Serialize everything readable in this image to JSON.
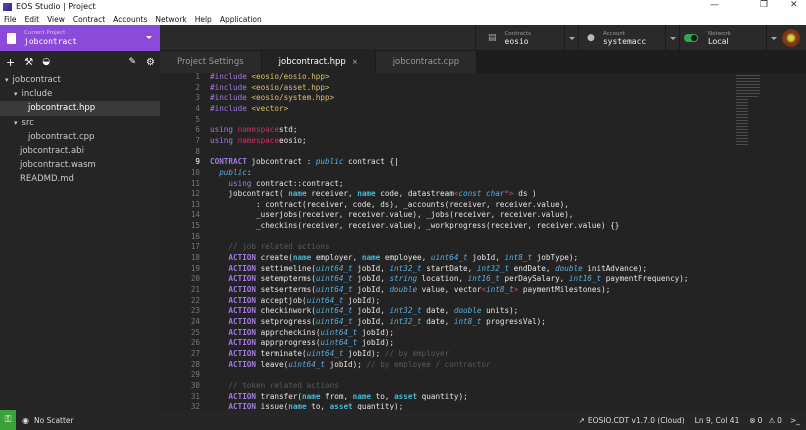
{
  "window": {
    "title": "EOS Studio | Project",
    "min": "—",
    "max": "❐",
    "close": "✕"
  },
  "menu": [
    "File",
    "Edit",
    "View",
    "Contract",
    "Accounts",
    "Network",
    "Help",
    "Application"
  ],
  "project": {
    "label": "Current Project",
    "value": "jobcontract"
  },
  "header": {
    "contracts": {
      "label": "Contracts",
      "value": "eosio"
    },
    "account": {
      "label": "Account",
      "value": "systemacc"
    },
    "network": {
      "label": "Network",
      "value": "Local"
    }
  },
  "tabs": [
    {
      "label": "Project Settings"
    },
    {
      "label": "jobcontract.hpp",
      "close": "×"
    },
    {
      "label": "jobcontract.cpp"
    }
  ],
  "tree": [
    {
      "label": "jobcontract",
      "arrow": "▾",
      "depth": 0
    },
    {
      "label": "include",
      "arrow": "▾",
      "depth": 1
    },
    {
      "label": "jobcontract.hpp",
      "depth": 2,
      "active": true
    },
    {
      "label": "src",
      "arrow": "▾",
      "depth": 1
    },
    {
      "label": "jobcontract.cpp",
      "depth": 2
    },
    {
      "label": "jobcontract.abi",
      "depth": 1
    },
    {
      "label": "jobcontract.wasm",
      "depth": 1
    },
    {
      "label": "READMD.md",
      "depth": 1
    }
  ],
  "code": [
    [
      [
        "u",
        "#include "
      ],
      [
        "s",
        "<eosio/eosio.hpp>"
      ]
    ],
    [
      [
        "u",
        "#include "
      ],
      [
        "s",
        "<eosio/asset.hpp>"
      ]
    ],
    [
      [
        "u",
        "#include "
      ],
      [
        "s",
        "<eosio/system.hpp>"
      ]
    ],
    [
      [
        "u",
        "#include "
      ],
      [
        "s",
        "<vector>"
      ]
    ],
    [],
    [
      [
        "u",
        "using "
      ],
      [
        "p",
        "namespace"
      ],
      [
        "",
        "std;"
      ]
    ],
    [
      [
        "u",
        "using "
      ],
      [
        "p",
        "namespace"
      ],
      [
        "",
        "eosio;"
      ]
    ],
    [],
    [
      [
        "k",
        "CONTRACT"
      ],
      [
        "",
        " jobcontract : "
      ],
      [
        "t",
        "public"
      ],
      [
        "",
        " contract {"
      ]
    ],
    [
      [
        "",
        "  "
      ],
      [
        "t",
        "public"
      ],
      [
        "",
        ":"
      ]
    ],
    [
      [
        "",
        "    "
      ],
      [
        "u",
        "using"
      ],
      [
        "",
        " contract::contract;"
      ]
    ],
    [
      [
        "",
        "    jobcontract( "
      ],
      [
        "n",
        "name"
      ],
      [
        "",
        " receiver, "
      ],
      [
        "n",
        "name"
      ],
      [
        "",
        " code, datastream"
      ],
      [
        "g",
        "<"
      ],
      [
        "t",
        "const char"
      ],
      [
        "g",
        "*>"
      ],
      [
        "",
        " ds )"
      ]
    ],
    [
      [
        "",
        "          : contract(receiver, code, ds), _accounts(receiver, receiver.value),"
      ]
    ],
    [
      [
        "",
        "          _userjobs(receiver, receiver.value), _jobs(receiver, receiver.value),"
      ]
    ],
    [
      [
        "",
        "          _checkins(receiver, receiver.value), _workprogress(receiver, receiver.value) {}"
      ]
    ],
    [],
    [
      [
        "c",
        "    // job related actions"
      ]
    ],
    [
      [
        "",
        "    "
      ],
      [
        "k",
        "ACTION"
      ],
      [
        "",
        " create("
      ],
      [
        "n",
        "name"
      ],
      [
        "",
        " employer, "
      ],
      [
        "n",
        "name"
      ],
      [
        "",
        " employee, "
      ],
      [
        "t",
        "uint64_t"
      ],
      [
        "",
        " jobId, "
      ],
      [
        "t",
        "int8_t"
      ],
      [
        "",
        " jobType);"
      ]
    ],
    [
      [
        "",
        "    "
      ],
      [
        "k",
        "ACTION"
      ],
      [
        "",
        " settimeline("
      ],
      [
        "t",
        "uint64_t"
      ],
      [
        "",
        " jobId, "
      ],
      [
        "t",
        "int32_t"
      ],
      [
        "",
        " startDate, "
      ],
      [
        "t",
        "int32_t"
      ],
      [
        "",
        " endDate, "
      ],
      [
        "t",
        "double"
      ],
      [
        "",
        " initAdvance);"
      ]
    ],
    [
      [
        "",
        "    "
      ],
      [
        "k",
        "ACTION"
      ],
      [
        "",
        " setempterms("
      ],
      [
        "t",
        "uint64_t"
      ],
      [
        "",
        " jobId, "
      ],
      [
        "t",
        "string"
      ],
      [
        "",
        " location, "
      ],
      [
        "t",
        "int16_t"
      ],
      [
        "",
        " perDaySalary, "
      ],
      [
        "t",
        "int16_t"
      ],
      [
        "",
        " paymentFrequency);"
      ]
    ],
    [
      [
        "",
        "    "
      ],
      [
        "k",
        "ACTION"
      ],
      [
        "",
        " setserterms("
      ],
      [
        "t",
        "uint64_t"
      ],
      [
        "",
        " jobId, "
      ],
      [
        "t",
        "double"
      ],
      [
        "",
        " value, vector"
      ],
      [
        "g",
        "<"
      ],
      [
        "t",
        "int8_t"
      ],
      [
        "g",
        ">"
      ],
      [
        "",
        " paymentMilestones);"
      ]
    ],
    [
      [
        "",
        "    "
      ],
      [
        "k",
        "ACTION"
      ],
      [
        "",
        " acceptjob("
      ],
      [
        "t",
        "uint64_t"
      ],
      [
        "",
        " jobId);"
      ]
    ],
    [
      [
        "",
        "    "
      ],
      [
        "k",
        "ACTION"
      ],
      [
        "",
        " checkinwork("
      ],
      [
        "t",
        "uint64_t"
      ],
      [
        "",
        " jobId, "
      ],
      [
        "t",
        "int32_t"
      ],
      [
        "",
        " date, "
      ],
      [
        "t",
        "double"
      ],
      [
        "",
        " units);"
      ]
    ],
    [
      [
        "",
        "    "
      ],
      [
        "k",
        "ACTION"
      ],
      [
        "",
        " setprogress("
      ],
      [
        "t",
        "uint64_t"
      ],
      [
        "",
        " jobId, "
      ],
      [
        "t",
        "int32_t"
      ],
      [
        "",
        " date, "
      ],
      [
        "t",
        "int8_t"
      ],
      [
        "",
        " progressVal);"
      ]
    ],
    [
      [
        "",
        "    "
      ],
      [
        "k",
        "ACTION"
      ],
      [
        "",
        " apprcheckins("
      ],
      [
        "t",
        "uint64_t"
      ],
      [
        "",
        " jobId);"
      ]
    ],
    [
      [
        "",
        "    "
      ],
      [
        "k",
        "ACTION"
      ],
      [
        "",
        " apprprogress("
      ],
      [
        "t",
        "uint64_t"
      ],
      [
        "",
        " jobId);"
      ]
    ],
    [
      [
        "",
        "    "
      ],
      [
        "k",
        "ACTION"
      ],
      [
        "",
        " terminate("
      ],
      [
        "t",
        "uint64_t"
      ],
      [
        "",
        " jobId); "
      ],
      [
        "c",
        "// by employer"
      ]
    ],
    [
      [
        "",
        "    "
      ],
      [
        "k",
        "ACTION"
      ],
      [
        "",
        " leave("
      ],
      [
        "t",
        "uint64_t"
      ],
      [
        "",
        " jobId); "
      ],
      [
        "c",
        "// by employee / contractor"
      ]
    ],
    [],
    [
      [
        "c",
        "    // token related actions"
      ]
    ],
    [
      [
        "",
        "    "
      ],
      [
        "k",
        "ACTION"
      ],
      [
        "",
        " transfer("
      ],
      [
        "n",
        "name"
      ],
      [
        "",
        " from, "
      ],
      [
        "n",
        "name"
      ],
      [
        "",
        " to, "
      ],
      [
        "n",
        "asset"
      ],
      [
        "",
        " quantity);"
      ]
    ],
    [
      [
        "",
        "    "
      ],
      [
        "k",
        "ACTION"
      ],
      [
        "",
        " issue("
      ],
      [
        "n",
        "name"
      ],
      [
        "",
        " to, "
      ],
      [
        "n",
        "asset"
      ],
      [
        "",
        " quantity);"
      ]
    ]
  ],
  "status": {
    "scatter": "No Scatter",
    "cdt": "EOSIO.CDT v1.7.0 (Cloud)",
    "position": "Ln 9, Col 41",
    "errors": "0",
    "warnings": "0",
    "terminal": ">_"
  },
  "colors": {
    "accent": "#8c4ad8",
    "status_key": "#3ba23b"
  }
}
